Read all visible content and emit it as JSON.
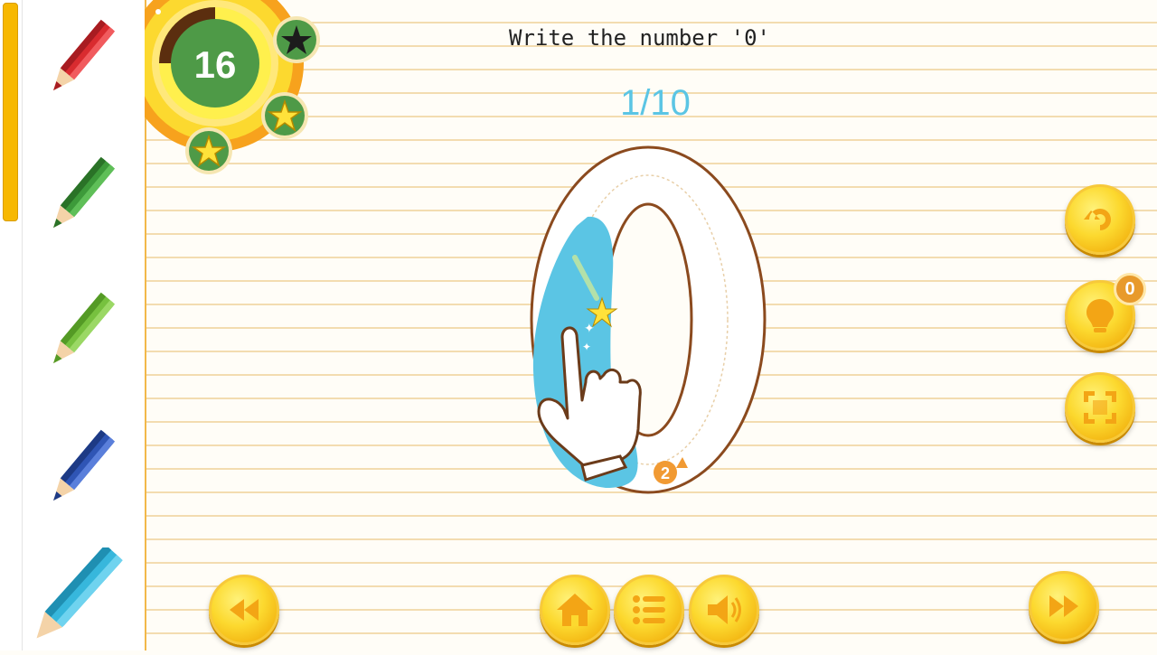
{
  "header": {
    "instruction": "Write the number '0'",
    "progress": "1/10"
  },
  "timer": {
    "seconds": "16",
    "remaining_fraction": 0.75,
    "stars": [
      "star-earned-dark",
      "star-gold",
      "star-gold"
    ]
  },
  "sidebar": {
    "scroll_position": 0,
    "pencils": [
      {
        "color": "red",
        "hex": "#d92b2f"
      },
      {
        "color": "dark-green",
        "hex": "#3d9a3a"
      },
      {
        "color": "light-green",
        "hex": "#77c13f"
      },
      {
        "color": "blue",
        "hex": "#2f55b5"
      },
      {
        "color": "cyan",
        "hex": "#37b7dc",
        "selected": true
      }
    ]
  },
  "tracing": {
    "digit": "0",
    "stroke_color": "#5bc5e4",
    "start_marker": "2",
    "trace_progress": 0.25
  },
  "right_controls": {
    "undo_icon": "undo-icon",
    "hint_icon": "lightbulb-icon",
    "hint_count": "0",
    "fullscreen_icon": "fullscreen-icon"
  },
  "bottom_controls": {
    "back_icon": "rewind-icon",
    "home_icon": "home-icon",
    "menu_icon": "list-menu-icon",
    "sound_icon": "speaker-icon",
    "next_icon": "fast-forward-icon"
  },
  "colors": {
    "accent_yellow": "#fcd92f",
    "timer_green": "#4e9a47",
    "paper_line": "#f3dcb0"
  }
}
